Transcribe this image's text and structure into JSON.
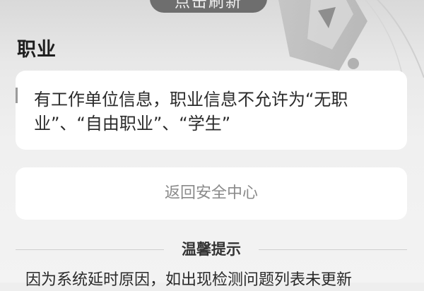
{
  "header": {
    "refresh_label": "点击刷新"
  },
  "section": {
    "title": "职业"
  },
  "card": {
    "text": "有工作单位信息，职业信息不允许为“无职业”、“自由职业”、“学生”"
  },
  "actions": {
    "return_label": "返回安全中心"
  },
  "tips": {
    "title": "温馨提示",
    "body": "因为系统延时原因，如出现检测问题列表未更新"
  },
  "icons": {
    "shield": "shield-icon"
  }
}
